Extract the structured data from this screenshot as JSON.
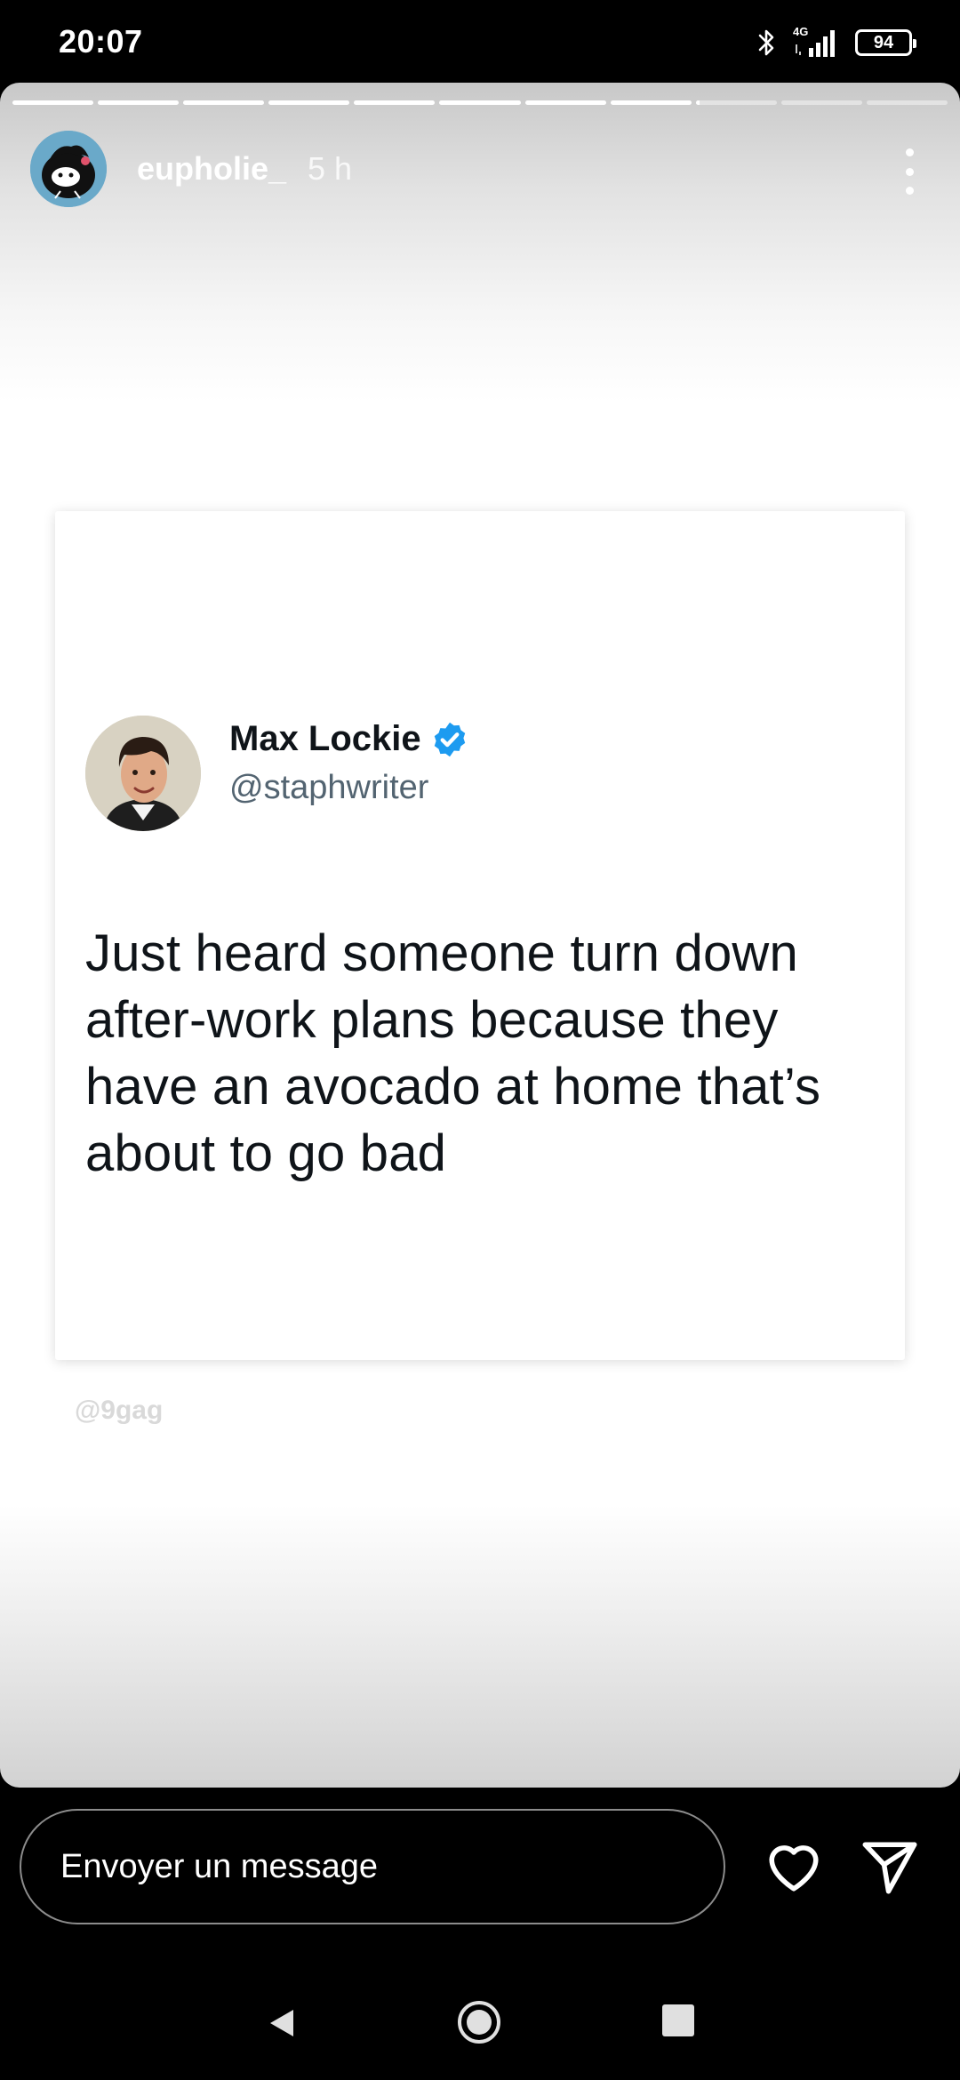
{
  "status_bar": {
    "time": "20:07",
    "network": "4G",
    "battery": "94"
  },
  "story": {
    "progress": {
      "total_segments": 11,
      "filled_segments": 8,
      "current_segment_progress": 0.05
    },
    "username": "eupholie_",
    "time_ago": "5 h",
    "tweet": {
      "author_name": "Max Lockie",
      "author_handle": "@staphwriter",
      "verified": true,
      "text": "Just heard someone turn down after-work plans because they have an avocado at home that’s about to go bad"
    },
    "watermark": "@9gag"
  },
  "message_bar": {
    "placeholder": "Envoyer un message"
  },
  "colors": {
    "verified_blue": "#1d9bf0",
    "story_background": "#ffffff",
    "screen_background": "#000000"
  },
  "icons": {
    "like": "heart-icon",
    "send": "paper-plane-icon",
    "more": "vertical-dots-icon",
    "nav_back": "triangle-back-icon",
    "nav_home": "circle-home-icon",
    "nav_recents": "square-recents-icon"
  }
}
